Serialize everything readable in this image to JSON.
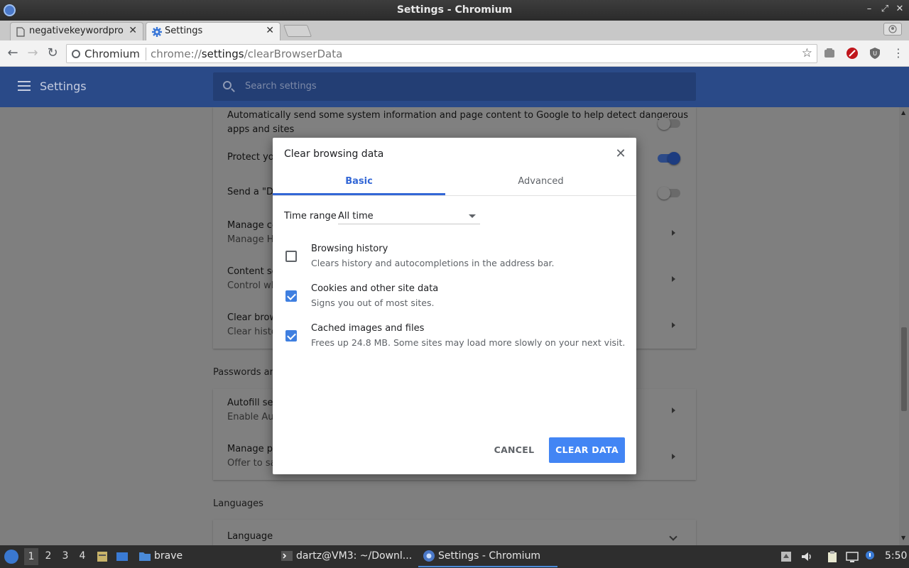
{
  "window": {
    "title": "Settings - Chromium",
    "controls": [
      "–",
      "⤢",
      "✕"
    ]
  },
  "tabs": [
    {
      "title": "negativekeywordpro",
      "icon": "document-icon",
      "active": false
    },
    {
      "title": "Settings",
      "icon": "gear-icon",
      "active": true
    }
  ],
  "toolbar": {
    "origin_label": "Chromium",
    "url_scheme": "chrome://",
    "url_host": "settings",
    "url_path": "/clearBrowserData",
    "back": "←",
    "forward": "→",
    "reload": "↻",
    "star": "☆"
  },
  "settings": {
    "header_title": "Settings",
    "search_placeholder": "Search settings",
    "rows": {
      "r1_line1": "Automatically send some system information and page content to Google to help detect dangerous",
      "r1_line2": "apps and sites",
      "r2": "Protect you",
      "r3": "Send a \"Do",
      "r4_title": "Manage ce",
      "r4_sub": "Manage HT",
      "r5_title": "Content se",
      "r5_sub": "Control wh",
      "r6_title": "Clear brows",
      "r6_sub": "Clear histor",
      "passwords_section": "Passwords and",
      "r7_title": "Autofill sett",
      "r7_sub": "Enable Auto",
      "r8_title": "Manage pa",
      "r8_sub": "Offer to sav",
      "languages_section": "Languages",
      "r9_title": "Language"
    }
  },
  "dialog": {
    "title": "Clear browsing data",
    "close": "✕",
    "tab_basic": "Basic",
    "tab_advanced": "Advanced",
    "time_range_label": "Time range",
    "time_range_value": "All time",
    "options": [
      {
        "label": "Browsing history",
        "desc": "Clears history and autocompletions in the address bar.",
        "checked": false
      },
      {
        "label": "Cookies and other site data",
        "desc": "Signs you out of most sites.",
        "checked": true
      },
      {
        "label": "Cached images and files",
        "desc": "Frees up 24.8 MB. Some sites may load more slowly on your next visit.",
        "checked": true
      }
    ],
    "cancel_label": "CANCEL",
    "clear_label": "CLEAR DATA"
  },
  "taskbar": {
    "workspaces": [
      "1",
      "2",
      "3",
      "4"
    ],
    "folder_label": "brave",
    "terminal_label": "dartz@VM3: ~/Downl...",
    "browser_label": "Settings - Chromium",
    "clock": "5:50"
  },
  "colors": {
    "accent": "#4285f4",
    "tab_accent": "#3367d6",
    "header": "#2a4a88"
  }
}
